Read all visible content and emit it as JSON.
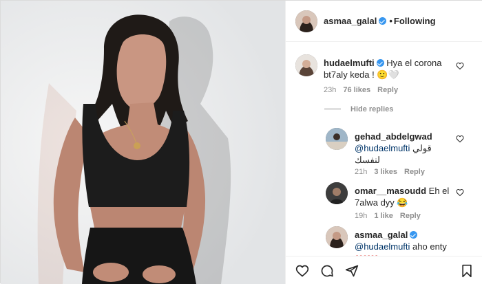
{
  "header": {
    "username": "asmaa_galal",
    "separator": "•",
    "follow_label": "Following"
  },
  "comments": [
    {
      "username": "hudaelmufti",
      "verified": true,
      "text": "Hya el corona bt7aly keda ! 🙂🤍",
      "time": "23h",
      "likes": "76 likes",
      "reply": "Reply"
    }
  ],
  "hide_replies": "Hide replies",
  "replies": [
    {
      "username": "gehad_abdelgwad",
      "mention": "@hudaelmufti",
      "text": "قولي لنفسك",
      "time": "21h",
      "likes": "3 likes",
      "reply": "Reply"
    },
    {
      "username": "omar__masoudd",
      "text": "Eh el 7alwa dyy 😂",
      "time": "19h",
      "likes": "1 like",
      "reply": "Reply"
    },
    {
      "username": "asmaa_galal",
      "verified": true,
      "mention": "@hudaelmufti",
      "text": "aho enty",
      "emojis": "❤️❤️❤️"
    }
  ],
  "icons": [
    "heart-icon",
    "comment-icon",
    "share-icon",
    "bookmark-icon"
  ],
  "colors": {
    "link": "#003569",
    "muted": "#8e8e8e",
    "verified": "#3897f0"
  }
}
